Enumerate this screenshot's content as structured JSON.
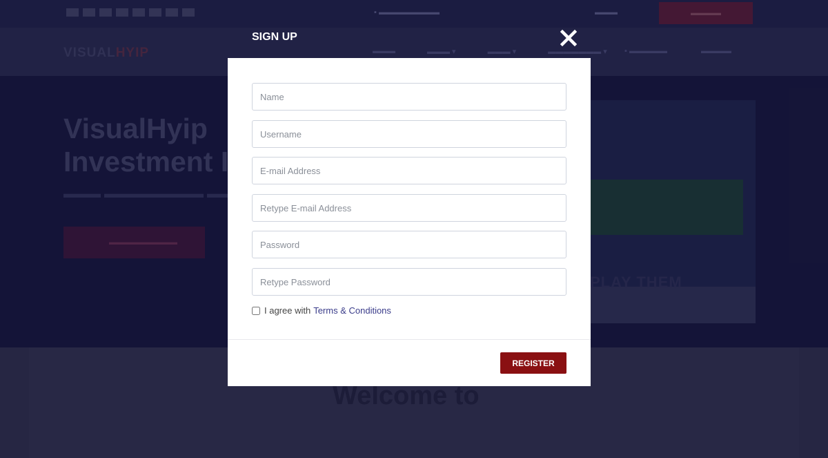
{
  "modal": {
    "title": "SIGN UP",
    "close_icon": "close-icon",
    "fields": [
      {
        "name": "name-input",
        "placeholder": "Name",
        "value": ""
      },
      {
        "name": "username-input",
        "placeholder": "Username",
        "value": ""
      },
      {
        "name": "email-input",
        "placeholder": "E-mail Address",
        "value": ""
      },
      {
        "name": "retype-email-input",
        "placeholder": "Retype E-mail Address",
        "value": ""
      },
      {
        "name": "password-input",
        "placeholder": "Password",
        "value": ""
      },
      {
        "name": "retype-password-input",
        "placeholder": "Retype Password",
        "value": ""
      }
    ],
    "agree_text": "I agree with",
    "terms_link": "Terms & Conditions",
    "agree_checked": false,
    "register_label": "REGISTER"
  },
  "background": {
    "logo_main": "VISUAL",
    "logo_accent": "HYIP",
    "hero_title_line1": "VisualHyip",
    "hero_title_line2": "Investment I",
    "welcome": "Welcome to",
    "hero_image_text": "PLAY THEM"
  },
  "colors": {
    "accent": "#8a1012",
    "link": "#3a3c8a",
    "overlay": "#1b1c44"
  }
}
